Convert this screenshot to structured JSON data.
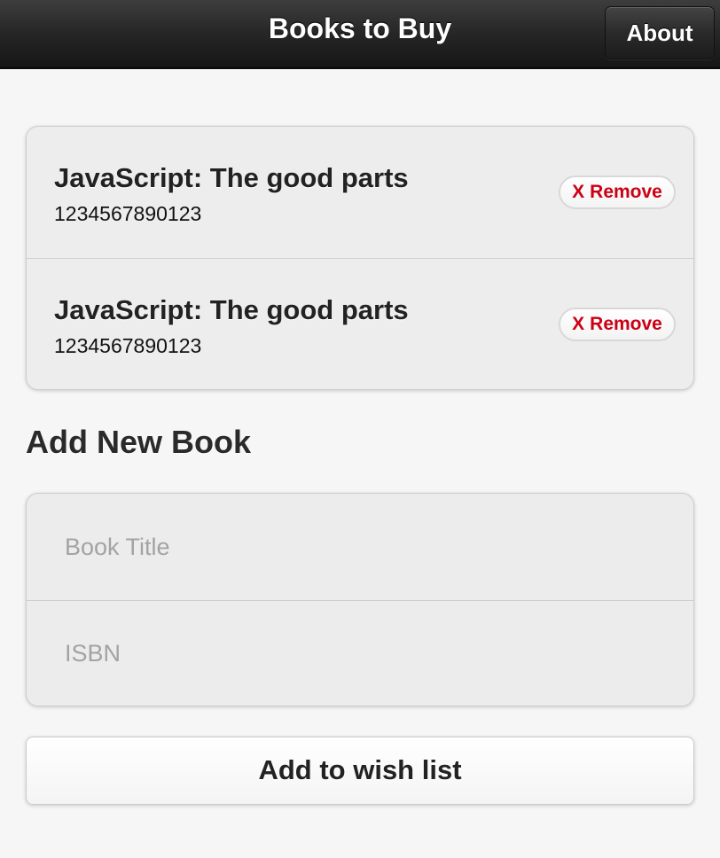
{
  "header": {
    "title": "Books to Buy",
    "about_label": "About"
  },
  "books": [
    {
      "title": "JavaScript: The good parts",
      "isbn": "1234567890123",
      "remove_icon": "X",
      "remove_label": "Remove"
    },
    {
      "title": "JavaScript: The good parts",
      "isbn": "1234567890123",
      "remove_icon": "X",
      "remove_label": "Remove"
    }
  ],
  "add_section": {
    "heading": "Add New Book",
    "title_placeholder": "Book Title",
    "isbn_placeholder": "ISBN",
    "submit_label": "Add to wish list"
  },
  "colors": {
    "header_bg": "#262626",
    "remove_text": "#cc0014",
    "page_bg": "#f6f6f6"
  }
}
